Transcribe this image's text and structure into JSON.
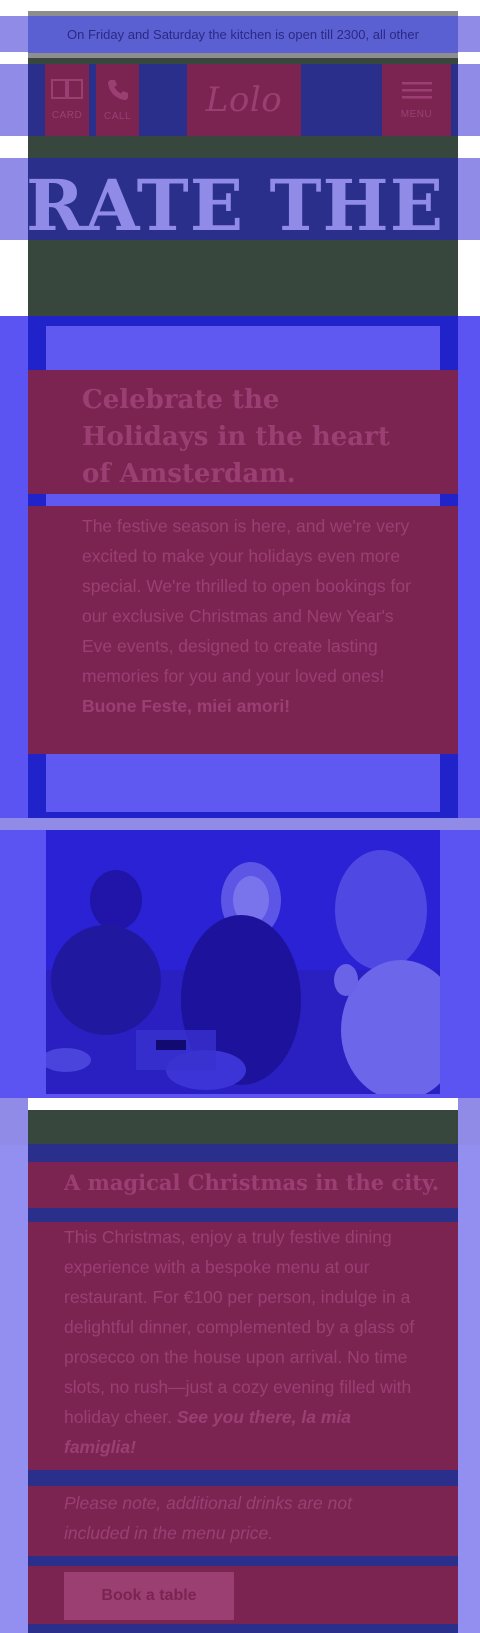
{
  "announcement": {
    "text": "On Friday and Saturday the kitchen is open till 2300, all other"
  },
  "nav": {
    "card_label": "CARD",
    "call_label": "CALL",
    "logo_text": "Lolo",
    "menu_label": "MENU"
  },
  "hero": {
    "headline": "RATE THE H"
  },
  "intro": {
    "title": "Celebrate the Holidays in the heart of Amsterdam.",
    "body": "The festive season is here, and we're very excited to make your holidays even more special. We're thrilled to open bookings for our exclusive Christmas and New Year's Eve events, designed to create lasting memories for you and your loved ones!",
    "body_emphasis": "Buone Feste, miei amori!"
  },
  "christmas": {
    "title": "A magical Christmas in the city.",
    "body": "This Christmas, enjoy a truly festive dining experience with a bespoke menu at our restaurant. For €100 per person, indulge in a delightful dinner, complemented by a glass of prosecco on the house upon arrival. No time slots, no rush—just a cozy evening filled with holiday cheer.",
    "body_emphasis": "See you there, la mia famiglia!",
    "note": "Please note, additional drinks are not included in the menu price.",
    "book_label": "Book a table"
  },
  "icons": {
    "card": "book-open-icon",
    "call": "phone-icon",
    "menu": "hamburger-menu-icon"
  },
  "colors": {
    "overlay_blue": "#8f8be6",
    "navy": "#2b2f8c",
    "dark_green": "#37473e",
    "magenta": "#7b2452",
    "magenta_text": "#9b3f72",
    "royal_blue": "#5b54f2"
  }
}
